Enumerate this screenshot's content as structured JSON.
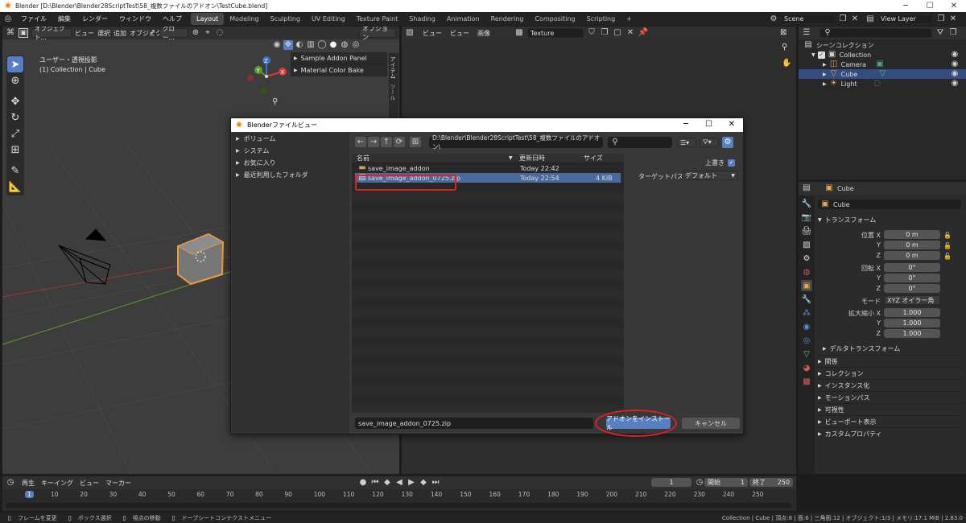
{
  "window": {
    "title": "Blender [D:\\Blender\\Blender28ScriptTest\\58_複数ファイルのアドオン\\TestCube.blend]",
    "minimize": "─",
    "maximize": "☐",
    "close": "✕"
  },
  "menubar": {
    "items": [
      "ファイル",
      "編集",
      "レンダー",
      "ウィンドウ",
      "ヘルプ"
    ],
    "workspaces": [
      "Layout",
      "Modeling",
      "Sculpting",
      "UV Editing",
      "Texture Paint",
      "Shading",
      "Animation",
      "Rendering",
      "Compositing",
      "Scripting",
      "+"
    ],
    "active_workspace": "Layout",
    "scene": "Scene",
    "view_layer": "View Layer"
  },
  "viewport": {
    "editor_dropdown": "オブジェクト...",
    "menus": [
      "ビュー",
      "選択",
      "追加",
      "オブジェクト"
    ],
    "transform_dropdown": "グロー...",
    "options": "オプション",
    "view_name": "ユーザー・透視投影",
    "collection_info": "(1) Collection | Cube",
    "panel_items": [
      "Sample Addon Panel",
      "Material Color Bake"
    ],
    "side_tabs": [
      "アイテム",
      "ツール"
    ],
    "gizmo": {
      "x": "X",
      "y": "Y",
      "z": "Z"
    }
  },
  "image_editor": {
    "menus": [
      "ビュー",
      "ビュー",
      "画像"
    ],
    "texture": "Texture"
  },
  "outliner": {
    "title": "シーンコレクション",
    "items": [
      {
        "label": "Collection",
        "level": 1
      },
      {
        "label": "Camera",
        "level": 2
      },
      {
        "label": "Cube",
        "level": 2,
        "selected": true
      },
      {
        "label": "Light",
        "level": 2
      }
    ]
  },
  "properties": {
    "object_name": "Cube",
    "object_name2": "Cube",
    "transform_title": "トランスフォーム",
    "location_label": "位置 X",
    "location": [
      "0 m",
      "0 m",
      "0 m"
    ],
    "rotation_label": "回転 X",
    "rotation": [
      "0°",
      "0°",
      "0°"
    ],
    "mode_label": "モード",
    "mode_value": "XYZ オイラー角",
    "scale_label": "拡大縮小 X",
    "scale": [
      "1.000",
      "1.000",
      "1.000"
    ],
    "axis_y": "Y",
    "axis_z": "Z",
    "delta": "デルタトランスフォーム",
    "sections": [
      "関係",
      "コレクション",
      "インスタンス化",
      "モーションパス",
      "可視性",
      "ビューポート表示",
      "カスタムプロパティ"
    ]
  },
  "file_dialog": {
    "title": "Blenderファイルビュー",
    "sidebar": [
      "ボリューム",
      "システム",
      "お気に入り",
      "最近利用したフォルダ"
    ],
    "path": "D:\\Blender\\Blender28ScriptTest\\58_複数ファイルのアドオン\\",
    "columns": {
      "name": "名前",
      "date": "更新日時",
      "size": "サイズ"
    },
    "files": [
      {
        "name": "save_image_addon",
        "date": "Today 22:42",
        "size": "",
        "type": "folder"
      },
      {
        "name": "save_image_addon_0725.zip",
        "date": "Today 22:54",
        "size": "4 KiB",
        "type": "file",
        "selected": true
      }
    ],
    "overwrite_label": "上書き",
    "target_path_label": "ターゲットパス",
    "target_path_value": "デフォルト",
    "filename": "save_image_addon_0725.zip",
    "install_button": "アドオンをインストール",
    "cancel_button": "キャンセル"
  },
  "timeline": {
    "menus": [
      "再生",
      "キーイング",
      "ビュー",
      "マーカー"
    ],
    "current_frame": "1",
    "start_label": "開始",
    "start": "1",
    "end_label": "終了",
    "end": "250",
    "ticks": [
      "1",
      "10",
      "20",
      "30",
      "40",
      "50",
      "60",
      "70",
      "80",
      "90",
      "100",
      "110",
      "120",
      "130",
      "140",
      "150",
      "160",
      "170",
      "180",
      "190",
      "200",
      "210",
      "220",
      "230",
      "240",
      "250"
    ]
  },
  "statusbar": {
    "left": [
      "フレームを変更",
      "ボックス選択",
      "視点の移動",
      "ドープシートコンテクストメニュー"
    ],
    "right": "Collection | Cube | 頂点:8 | 面:6 | 三角面:12 | オブジェクト:1/3 | メモリ:17.1 MiB | 2.83.0"
  },
  "colors": {
    "accent": "#5680c2",
    "selection_highlight": "#e02020",
    "cube_outline": "#f39c34"
  }
}
